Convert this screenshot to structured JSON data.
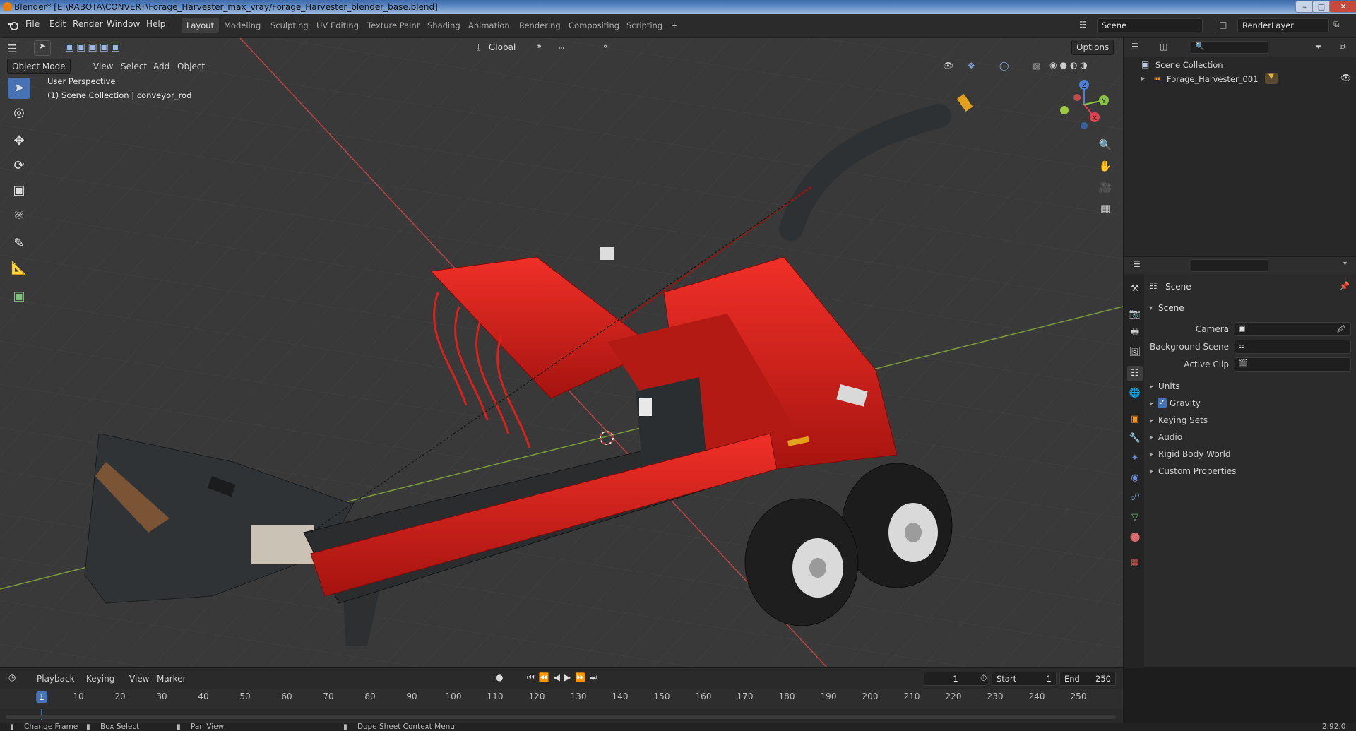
{
  "window": {
    "title": "Blender* [E:\\RABOTA\\CONVERT\\Forage_Harvester_max_vray/Forage_Harvester_blender_base.blend]",
    "minimize": "–",
    "maximize": "□",
    "close": "✕"
  },
  "menubar": [
    "File",
    "Edit",
    "Render",
    "Window",
    "Help"
  ],
  "workspaces": [
    "Layout",
    "Modeling",
    "Sculpting",
    "UV Editing",
    "Texture Paint",
    "Shading",
    "Animation",
    "Rendering",
    "Compositing",
    "Scripting",
    "+"
  ],
  "active_workspace": "Layout",
  "scene_selector": "Scene",
  "view_layer": "RenderLayer",
  "viewport": {
    "mode": "Object Mode",
    "menus": [
      "View",
      "Select",
      "Add",
      "Object"
    ],
    "transform_orientation": "Global",
    "options_label": "Options",
    "overlay_title": "User Perspective",
    "overlay_subtitle": "(1) Scene Collection | conveyor_rod",
    "gizmo_axes": {
      "z": "Z",
      "y": "Y",
      "x": "X"
    }
  },
  "outliner": {
    "root": "Scene Collection",
    "items": [
      {
        "label": "Forage_Harvester_001"
      }
    ]
  },
  "properties": {
    "context": "Scene",
    "panel_title": "Scene",
    "fields": [
      {
        "label": "Camera"
      },
      {
        "label": "Background Scene"
      },
      {
        "label": "Active Clip"
      }
    ],
    "sections": [
      {
        "label": "Units",
        "checkbox": false
      },
      {
        "label": "Gravity",
        "checkbox": true
      },
      {
        "label": "Keying Sets",
        "checkbox": false
      },
      {
        "label": "Audio",
        "checkbox": false
      },
      {
        "label": "Rigid Body World",
        "checkbox": false
      },
      {
        "label": "Custom Properties",
        "checkbox": false
      }
    ]
  },
  "timeline": {
    "menus": [
      "Playback",
      "Keying",
      "View",
      "Marker"
    ],
    "current_frame": "1",
    "start_label": "Start",
    "start": "1",
    "end_label": "End",
    "end": "250",
    "ticks": [
      "1",
      "10",
      "20",
      "30",
      "40",
      "50",
      "60",
      "70",
      "80",
      "90",
      "100",
      "110",
      "120",
      "130",
      "140",
      "150",
      "160",
      "170",
      "180",
      "190",
      "200",
      "210",
      "220",
      "230",
      "240",
      "250"
    ]
  },
  "statusbar": {
    "items": [
      "Change Frame",
      "Box Select",
      "Pan View",
      "Dope Sheet Context Menu"
    ],
    "version": "2.92.0"
  },
  "colors": {
    "accent": "#4772b3",
    "model_red": "#d8221c",
    "axis_x": "#c53b3b",
    "axis_y": "#6f9b2c"
  }
}
